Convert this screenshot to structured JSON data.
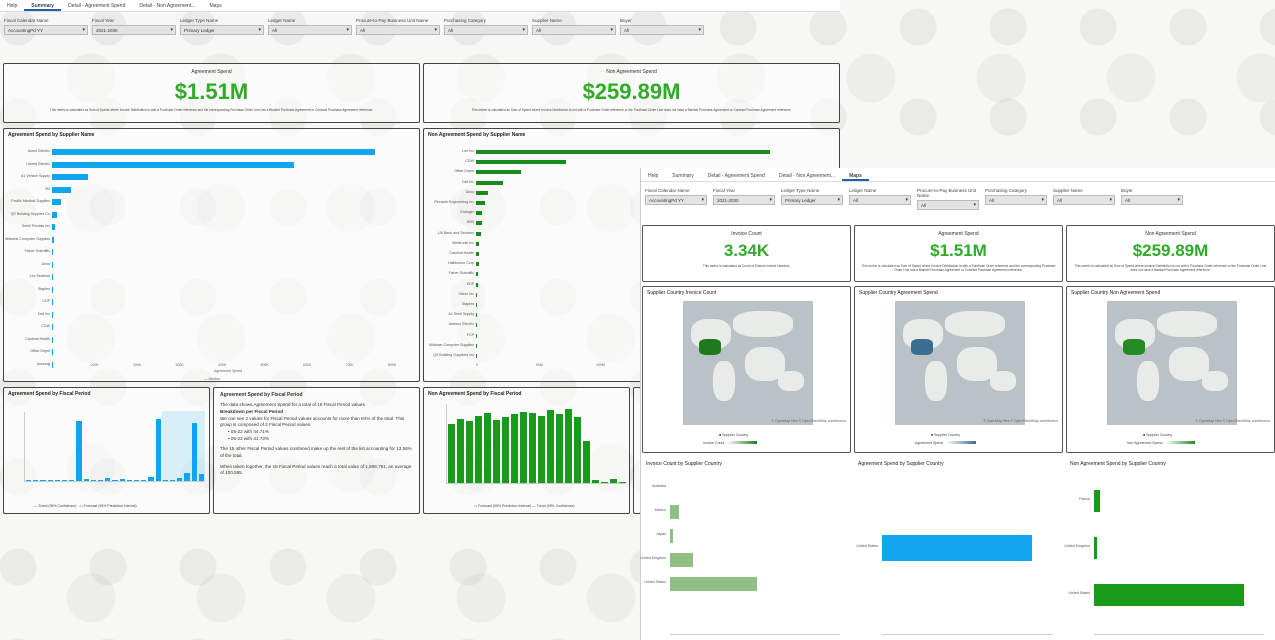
{
  "tabs": [
    "Help",
    "Summary",
    "Detail - Agreement Spend",
    "Detail - Non Agreement...",
    "Maps"
  ],
  "filters": [
    {
      "label": "Fiscal Calendar Name",
      "value": "AccountingPd YY"
    },
    {
      "label": "Fiscal Year",
      "value": "2021-2030"
    },
    {
      "label": "Ledger Type Name",
      "value": "Primary Ledger"
    },
    {
      "label": "Ledger Name",
      "value": "All"
    },
    {
      "label": "Procure-to-Pay Business Unit Name",
      "value": "All"
    },
    {
      "label": "Purchasing Category",
      "value": "All"
    },
    {
      "label": "Supplier Name",
      "value": "All"
    },
    {
      "label": "Buyer",
      "value": "All"
    }
  ],
  "kpis": {
    "agreement": {
      "title": "Agreement Spend",
      "value": "$1.51M",
      "desc": "This metric is calculated as Sum of Spend where Invoice Distribution is with a Purchase Order reference and the corresponding Purchase Order Line has a Blanket Purchase Agreement or Contract Purchase Agreement reference."
    },
    "non_agreement": {
      "title": "Non Agreement Spend",
      "value": "$259.89M",
      "desc": "This metric is calculated as Sum of Spend where Invoice Distribution is not with a Purchase Order reference or the Purchase Order Line does not have a Blanket Purchase Agreement or Contract Purchase Agreement reference."
    }
  },
  "agreement_by_supplier": {
    "title": "Agreement Spend by Supplier Name",
    "suppliers": [
      "Acme Electric",
      "Liberty Electric",
      "A1 Vehicle Supply",
      "3M",
      "Pacific Medical Supplies",
      "QS Building Supplies Co",
      "Smith Rentals Inc",
      "Midwest Computer Supplies",
      "Fisher Scientific",
      "Airco",
      "Lee Seafood",
      "Staples",
      "CDP",
      "Dell Inc",
      "CDW",
      "Cardinal Health",
      "Office Depot",
      "Amazon"
    ],
    "values": [
      760,
      570,
      85,
      45,
      22,
      12,
      6,
      4,
      3,
      3,
      2,
      2,
      2,
      1,
      1,
      1,
      1,
      1
    ],
    "x_ticks": [
      "0",
      "100K",
      "200K",
      "300K",
      "400K",
      "500K",
      "600K",
      "700K",
      "800K"
    ],
    "x_label": "Agreement Spend",
    "legend": "Median"
  },
  "non_agreement_by_supplier": {
    "title": "Non Agreement Spend by Supplier Name",
    "suppliers": [
      "Lee Inc",
      "CDW",
      "Office Depot",
      "Dell Inc",
      "Airco",
      "Pinnacle Engineering Inc",
      "Grainger",
      "BSN",
      "US Bank and Services",
      "Medtronic Inc",
      "Carolina Health",
      "Halliburton Corp",
      "Fisher Scientific",
      "EDF",
      "Vision Inc",
      "Staples",
      "A1 Steel Supply",
      "Ameron Electric",
      "FCP",
      "Midtown Computer Supplies",
      "QS Building Suppliers Inc"
    ],
    "values": [
      98,
      30,
      15,
      9,
      4,
      3,
      2,
      2,
      1.5,
      1,
      1,
      1,
      0.6,
      0.5,
      0.4,
      0.3,
      0.3,
      0.2,
      0.2,
      0.2,
      0.1
    ],
    "x_ticks": [
      "0",
      "50M",
      "100M"
    ]
  },
  "agreement_by_period": {
    "title": "Agreement Spend by Fiscal Period",
    "values": [
      0,
      0,
      0,
      0,
      0,
      1,
      0,
      60,
      2,
      0,
      0,
      3,
      1,
      2,
      0,
      0,
      0,
      4,
      62,
      0,
      1,
      3,
      8,
      58,
      7
    ],
    "legend_a": "Trend (95% Confidence)",
    "legend_b": "Forecast (95% Prediction Interval)",
    "y_label": "Agreement Spend"
  },
  "narrative": {
    "title": "Agreement Spend by Fiscal Period",
    "p1": "The data shows Agreement Spend for a total of 18 Fiscal Period values.",
    "p2_bold": "Breakdown per Fiscal Period",
    "p2": "We can see 2 values for Fiscal Period values accounts for more than 84% of the total. This group is composed of 2 Fiscal Period values.",
    "b1": "05-22 with 44.71%",
    "b2": "05-22 with 41.73%",
    "p3": "The 15 other Fiscal Period values combined make up the rest of the list accounting for 13.56% of the total.",
    "p4": "When taken together, the 18 Fiscal Period values reach a total value of 1,508,781, an average of 100,585."
  },
  "non_agreement_by_period": {
    "title": "Non Agreement Spend by Fiscal Period",
    "values": [
      42,
      46,
      44,
      48,
      50,
      45,
      47,
      49,
      51,
      50,
      48,
      52,
      49,
      53,
      47,
      30,
      2,
      1,
      3,
      1
    ],
    "legend_a": "Forecast (95% Prediction Interval)",
    "legend_b": "Trend (95% Confidence)",
    "y_label": "Non Agreement Spend"
  },
  "overlay": {
    "tabs": [
      "Help",
      "Summary",
      "Detail - Agreement Spend",
      "Detail - Non Agreement...",
      "Maps"
    ],
    "filters": [
      {
        "label": "Fiscal Calendar Name",
        "value": "AccountingPd YY"
      },
      {
        "label": "Fiscal Year",
        "value": "2021-2030"
      },
      {
        "label": "Ledger Type Name",
        "value": "Primary Ledger"
      },
      {
        "label": "Ledger Name",
        "value": "All"
      },
      {
        "label": "Procure-to-Pay Business Unit Name",
        "value": "All"
      },
      {
        "label": "Purchasing Category",
        "value": "All"
      },
      {
        "label": "Supplier Name",
        "value": "All"
      },
      {
        "label": "Buyer",
        "value": "All"
      }
    ],
    "kpis": [
      {
        "title": "Invoice Count",
        "value": "3.34K",
        "color": "#2eab27",
        "desc": "This metric is calculated as Count of Distinct Invoice Headers."
      },
      {
        "title": "Agreement Spend",
        "value": "$1.51M",
        "color": "#2eab27",
        "desc": "This metric is calculated as Sum of Spend where Invoice Distribution is with a Purchase Order reference and the corresponding Purchase Order Line has a Blanket Purchase Agreement or Contract Purchase Agreement reference."
      },
      {
        "title": "Non Agreement Spend",
        "value": "$259.89M",
        "color": "#2eab27",
        "desc": "This metric is calculated as Sum of Spend where Invoice Distribution is not with a Purchase Order reference or the Purchase Order Line does not have a Blanket Purchase Agreement reference."
      }
    ],
    "maps": [
      {
        "title": "Supplier Country Invoice Count",
        "legend": "Supplier Country",
        "legend2": "Invoice Count",
        "attrib": "© OpenMapTiles © OpenStreetMap contributors"
      },
      {
        "title": "Supplier Country Agreement Spend",
        "legend": "Supplier Country",
        "legend2": "Agreement Spend",
        "attrib": "© OpenMapTiles © OpenStreetMap contributors"
      },
      {
        "title": "Supplier Country Non Agreement Spend",
        "legend": "Supplier Country",
        "legend2": "Non Agreement Spend",
        "attrib": "© OpenMapTiles © OpenStreetMap contributors"
      }
    ],
    "bars": [
      {
        "title": "Invoice Count by Supplier Country",
        "cats": [
          "Australia",
          "Mexico",
          "Japan",
          "United Kingdom",
          "United States"
        ],
        "values": [
          0,
          6,
          2,
          15,
          58
        ],
        "color": "#8fbf85"
      },
      {
        "title": "Agreement Spend by Supplier Country",
        "cats": [
          "United States"
        ],
        "values": [
          100
        ],
        "color": "#12a5ef"
      },
      {
        "title": "Non Agreement Spend by Supplier Country",
        "cats": [
          "France",
          "United Kingdom",
          "United States"
        ],
        "values": [
          4,
          2,
          100
        ],
        "color": "#1a9a1a"
      }
    ]
  }
}
